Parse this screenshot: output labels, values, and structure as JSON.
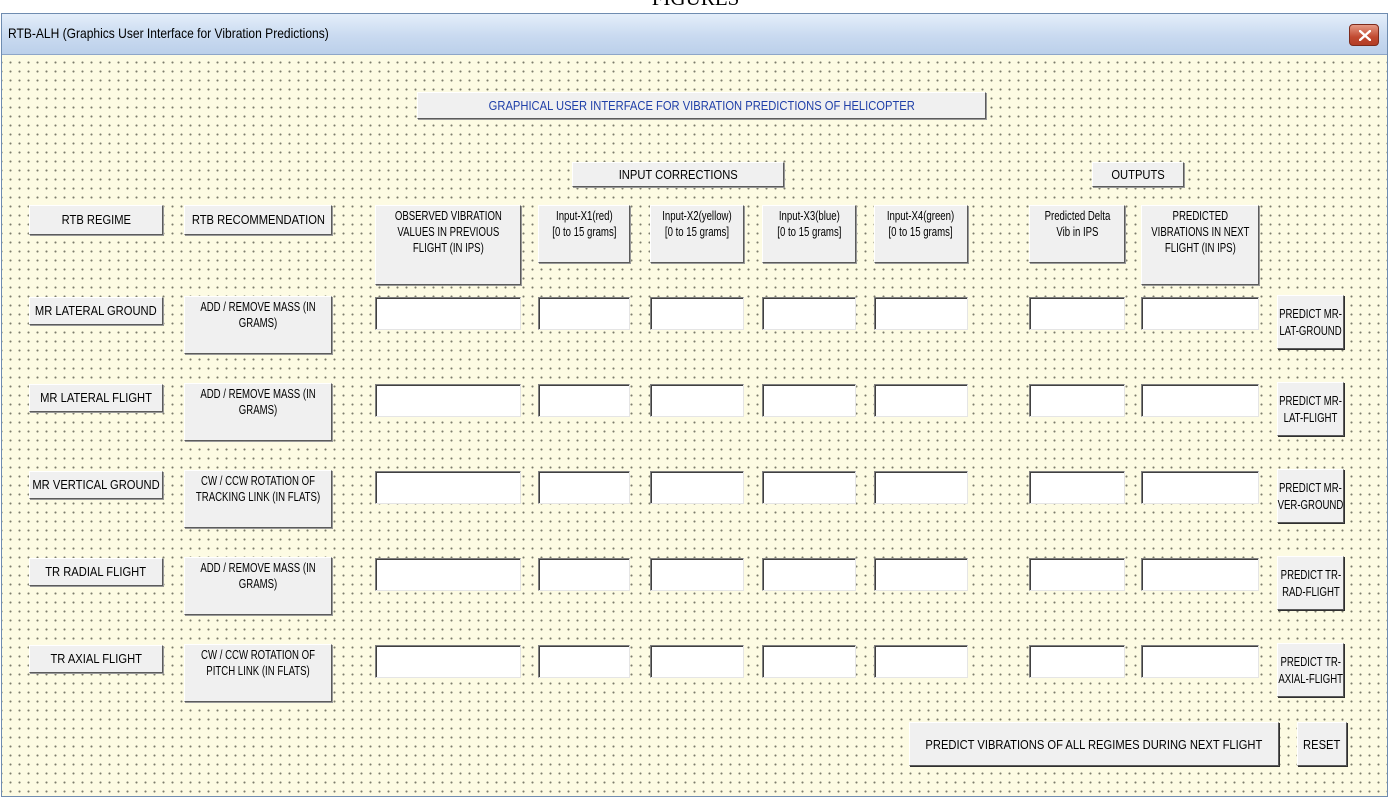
{
  "page_caption_fragment": "FIGURES",
  "window": {
    "title": "RTB-ALH (Graphics User Interface for Vibration Predictions)",
    "close_icon": "close-icon",
    "close_color": "#c14a31"
  },
  "banner": {
    "title": "GRAPHICAL USER INTERFACE FOR VIBRATION PREDICTIONS OF HELICOPTER"
  },
  "sections": {
    "inputs": "INPUT CORRECTIONS",
    "outputs": "OUTPUTS"
  },
  "headers": {
    "regime": "RTB REGIME",
    "recommendation": "RTB RECOMMENDATION",
    "observed": [
      "OBSERVED VIBRATION",
      "VALUES IN PREVIOUS",
      "FLIGHT (IN IPS)"
    ],
    "x1": [
      "Input-X1(red)",
      "[0 to 15 grams]"
    ],
    "x2": [
      "Input-X2(yellow)",
      "[0 to 15 grams]"
    ],
    "x3": [
      "Input-X3(blue)",
      "[0 to 15 grams]"
    ],
    "x4": [
      "Input-X4(green)",
      "[0 to 15 grams]"
    ],
    "delta": [
      "Predicted Delta",
      "Vib in IPS"
    ],
    "predicted": [
      "PREDICTED",
      "VIBRATIONS IN NEXT",
      "FLIGHT (IN IPS)"
    ]
  },
  "rows": [
    {
      "regime": "MR LATERAL GROUND",
      "recommendation": [
        "ADD / REMOVE MASS (IN",
        "GRAMS)"
      ],
      "button": [
        "PREDICT MR-",
        "LAT-GROUND"
      ],
      "values": {
        "observed": "",
        "x1": "",
        "x2": "",
        "x3": "",
        "x4": "",
        "delta": "",
        "predicted": ""
      }
    },
    {
      "regime": "MR LATERAL FLIGHT",
      "recommendation": [
        "ADD / REMOVE MASS (IN",
        "GRAMS)"
      ],
      "button": [
        "PREDICT MR-",
        "LAT-FLIGHT"
      ],
      "values": {
        "observed": "",
        "x1": "",
        "x2": "",
        "x3": "",
        "x4": "",
        "delta": "",
        "predicted": ""
      }
    },
    {
      "regime": "MR VERTICAL GROUND",
      "recommendation": [
        "CW / CCW ROTATION OF",
        "TRACKING LINK (IN FLATS)"
      ],
      "button": [
        "PREDICT MR-",
        "VER-GROUND"
      ],
      "values": {
        "observed": "",
        "x1": "",
        "x2": "",
        "x3": "",
        "x4": "",
        "delta": "",
        "predicted": ""
      }
    },
    {
      "regime": "TR RADIAL FLIGHT",
      "recommendation": [
        "ADD / REMOVE MASS (IN",
        "GRAMS)"
      ],
      "button": [
        "PREDICT TR-",
        "RAD-FLIGHT"
      ],
      "values": {
        "observed": "",
        "x1": "",
        "x2": "",
        "x3": "",
        "x4": "",
        "delta": "",
        "predicted": ""
      }
    },
    {
      "regime": "TR AXIAL FLIGHT",
      "recommendation": [
        "CW / CCW ROTATION OF",
        "PITCH LINK (IN FLATS)"
      ],
      "button": [
        "PREDICT TR-",
        "AXIAL-FLIGHT"
      ],
      "values": {
        "observed": "",
        "x1": "",
        "x2": "",
        "x3": "",
        "x4": "",
        "delta": "",
        "predicted": ""
      }
    }
  ],
  "footer": {
    "predict_all": "PREDICT VIBRATIONS OF ALL REGIMES DURING NEXT FLIGHT",
    "reset": "RESET"
  },
  "colors": {
    "canvas": "#fdfbe3",
    "control_face": "#f0f0f0",
    "banner_text": "#1f3fa8",
    "titlebar": "#c9daf0"
  }
}
